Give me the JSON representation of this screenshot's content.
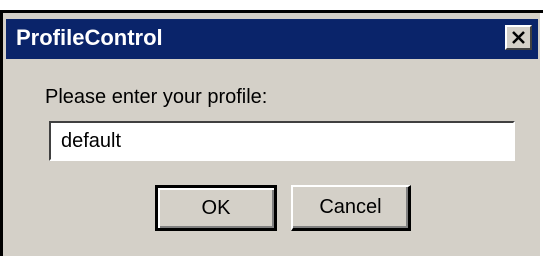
{
  "window": {
    "title": "ProfileControl",
    "close_icon": "close-icon"
  },
  "dialog": {
    "prompt": "Please enter your profile:",
    "profile_value": "default",
    "ok_label": "OK",
    "cancel_label": "Cancel"
  },
  "colors": {
    "titlebar": "#0a246a",
    "face": "#d4d0c8"
  }
}
